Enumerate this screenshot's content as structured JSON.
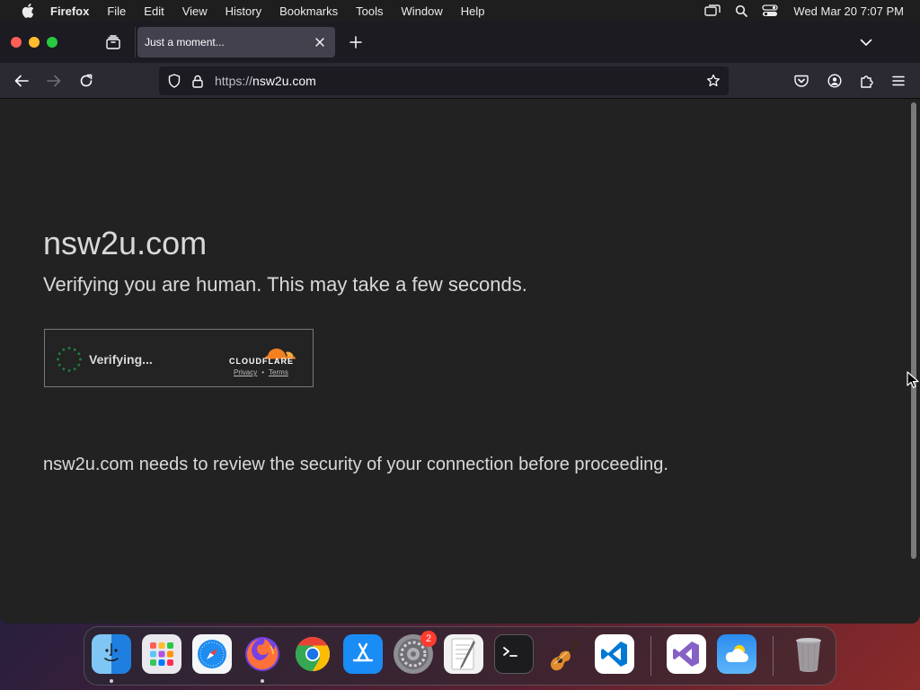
{
  "menubar": {
    "app_name": "Firefox",
    "items": [
      "File",
      "Edit",
      "View",
      "History",
      "Bookmarks",
      "Tools",
      "Window",
      "Help"
    ],
    "clock": "Wed Mar 20  7:07 PM"
  },
  "browser": {
    "tab": {
      "title": "Just a moment..."
    },
    "url": {
      "protocol": "https://",
      "host": "nsw2u.com"
    }
  },
  "page": {
    "site_title": "nsw2u.com",
    "verifying_message": "Verifying you are human. This may take a few seconds.",
    "widget": {
      "status": "Verifying...",
      "brand": "CLOUDFLARE",
      "privacy_link": "Privacy",
      "separator": "•",
      "terms_link": "Terms"
    },
    "security_message": "nsw2u.com needs to review the security of your connection before proceeding."
  },
  "dock": {
    "apps": [
      "finder-icon",
      "launchpad-icon",
      "safari-icon",
      "firefox-icon",
      "chrome-icon",
      "app-store-icon",
      "system-settings-icon",
      "textedit-icon",
      "terminal-icon",
      "garageband-icon",
      "vscode-icon",
      "visual-studio-icon",
      "weather-icon",
      "trash-icon"
    ],
    "settings_badge": "2"
  },
  "colors": {
    "page_background": "#222222",
    "cloudflare_orange": "#f38020",
    "tab_active": "#42414d"
  }
}
